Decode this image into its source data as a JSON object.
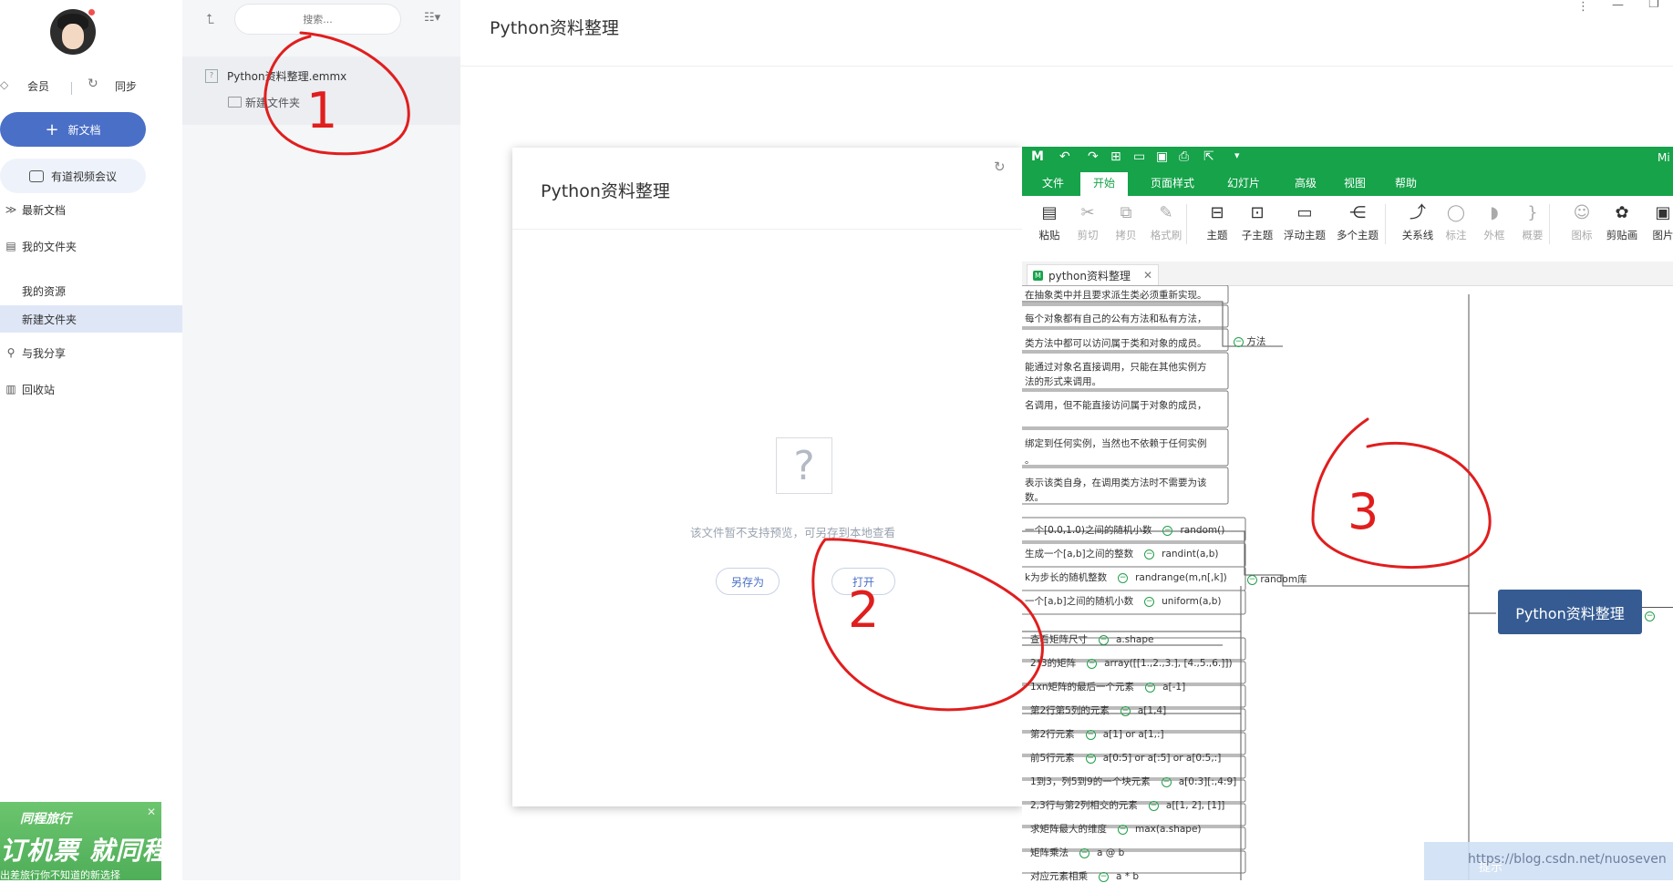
{
  "sidebar": {
    "member_label": "会员",
    "sync_label": "同步",
    "new_doc_label": "新文档",
    "meeting_label": "有道视频会议",
    "nav": {
      "recent": "最新文档",
      "my_folder": "我的文件夹",
      "my_resources": "我的资源",
      "new_folder": "新建文件夹",
      "shared": "与我分享",
      "recycle": "回收站"
    },
    "ad": {
      "brand": "同程旅行",
      "slogan": "订机票 就同程.",
      "small": "出差旅行你不知道的新选择"
    }
  },
  "filepanel": {
    "search_placeholder": "搜索...",
    "file_name": "Python资料整理.emmx",
    "folder_name": "新建文件夹"
  },
  "main": {
    "title": "Python资料整理"
  },
  "preview": {
    "title": "Python资料整理",
    "question_glyph": "?",
    "message": "该文件暂不支持预览，可另存到本地查看",
    "save_as": "另存为",
    "open": "打开"
  },
  "mindmap_app": {
    "title_fragment": "Mi",
    "menu": [
      "文件",
      "开始",
      "页面样式",
      "幻灯片",
      "高级",
      "视图",
      "帮助"
    ],
    "active_menu_index": 1,
    "ribbon": [
      {
        "label": "粘贴",
        "icon": "paste-icon",
        "dim": false
      },
      {
        "label": "剪切",
        "icon": "cut-icon",
        "dim": true
      },
      {
        "label": "拷贝",
        "icon": "copy-icon",
        "dim": true
      },
      {
        "label": "格式刷",
        "icon": "format-brush-icon",
        "dim": true
      },
      {
        "label": "主题",
        "icon": "topic-icon",
        "dim": false
      },
      {
        "label": "子主题",
        "icon": "subtopic-icon",
        "dim": false
      },
      {
        "label": "浮动主题",
        "icon": "floating-topic-icon",
        "dim": false
      },
      {
        "label": "多个主题",
        "icon": "multi-topic-icon",
        "dim": false
      },
      {
        "label": "关系线",
        "icon": "relation-icon",
        "dim": false
      },
      {
        "label": "标注",
        "icon": "callout-icon",
        "dim": true
      },
      {
        "label": "外框",
        "icon": "boundary-icon",
        "dim": true
      },
      {
        "label": "概要",
        "icon": "summary-icon",
        "dim": true
      },
      {
        "label": "图标",
        "icon": "mark-icon",
        "dim": true
      },
      {
        "label": "剪贴画",
        "icon": "clipart-icon",
        "dim": false
      },
      {
        "label": "图片",
        "icon": "image-icon",
        "dim": false
      }
    ],
    "doc_tab": "python资料整理",
    "root_node": "Python资料整理",
    "method_branch": "方法",
    "method_notes": [
      "在抽象类中并且要求派生类必须重新实现。",
      "每个对象都有自己的公有方法和私有方法，",
      "类方法中都可以访问属于类和对象的成员。",
      "能通过对象名直接调用，只能在其他实例方",
      "法的形式来调用。",
      "名调用，但不能直接访问属于对象的成员，",
      "绑定到任何实例，当然也不依赖于任何实例",
      "。",
      "表示该类自身，在调用类方法时不需要为该",
      "数。"
    ],
    "random_branch": "random库",
    "random_items": [
      {
        "desc": "一个[0.0,1.0)之间的随机小数",
        "func": "random()"
      },
      {
        "desc": "生成一个[a,b]之间的整数",
        "func": "randint(a,b)"
      },
      {
        "desc": "k为步长的随机整数",
        "func": "randrange(m,n[,k])"
      },
      {
        "desc": "一个[a,b]之间的随机小数",
        "func": "uniform(a,b)"
      }
    ],
    "array_items": [
      {
        "desc": "查看矩阵尺寸",
        "func": "a.shape"
      },
      {
        "desc": "2*3的矩阵",
        "func": "array([[1.,2.,3.], [4.,5.,6.]])"
      },
      {
        "desc": "1xn矩阵的最后一个元素",
        "func": "a[-1]"
      },
      {
        "desc": "第2行第5列的元素",
        "func": "a[1,4]"
      },
      {
        "desc": "第2行元素",
        "func": "a[1] or a[1,:]"
      },
      {
        "desc": "前5行元素",
        "func": "a[0:5] or a[:5] or a[0:5,:]"
      },
      {
        "desc": "1到3，列5到9的一个块元素",
        "func": "a[0:3][:,4:9]"
      },
      {
        "desc": "2,3行与第2列相交的元素",
        "func": "a[[1, 2], [1]]"
      },
      {
        "desc": "求矩阵最大的维度",
        "func": "max(a.shape)"
      },
      {
        "desc": "矩阵乘法",
        "func": "a @ b"
      },
      {
        "desc": "对应元素相乘",
        "func": "a * b"
      }
    ]
  },
  "annotations": {
    "mark1": "1",
    "mark2": "2",
    "mark3": "3"
  },
  "overlay": {
    "tip": "提示",
    "watermark": "https://blog.csdn.net/nuoseven"
  }
}
